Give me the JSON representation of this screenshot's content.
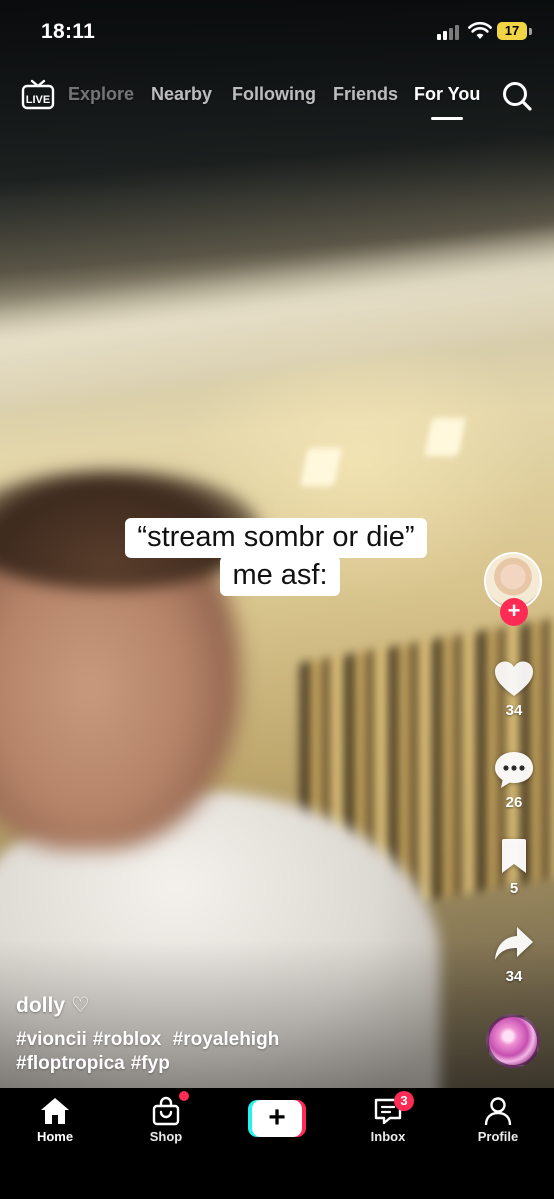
{
  "status_bar": {
    "time": "18:11",
    "battery": "17"
  },
  "top_nav": {
    "live_label": "LIVE",
    "tabs": [
      "Explore",
      "Nearby",
      "Following",
      "Friends",
      "For You"
    ],
    "active_tab": "For You"
  },
  "video": {
    "caption_lines": [
      "“stream sombr or die”",
      "me asf:"
    ]
  },
  "creator": {
    "username": "dolly ♡",
    "follow_symbol": "+"
  },
  "actions": {
    "likes": "34",
    "comments": "26",
    "saves": "5",
    "shares": "34"
  },
  "description": {
    "hashtags_line1": [
      "#vioncii",
      "#roblox",
      "#royalehigh"
    ],
    "hashtags_line2": [
      "#floptropica",
      "#fyp"
    ]
  },
  "tab_bar": {
    "home": "Home",
    "shop": "Shop",
    "create_symbol": "+",
    "inbox": "Inbox",
    "profile": "Profile",
    "inbox_badge": "3"
  },
  "colors": {
    "accent_red": "#fe2c55",
    "accent_cyan": "#25f4ee",
    "battery_yellow": "#f1d545"
  }
}
